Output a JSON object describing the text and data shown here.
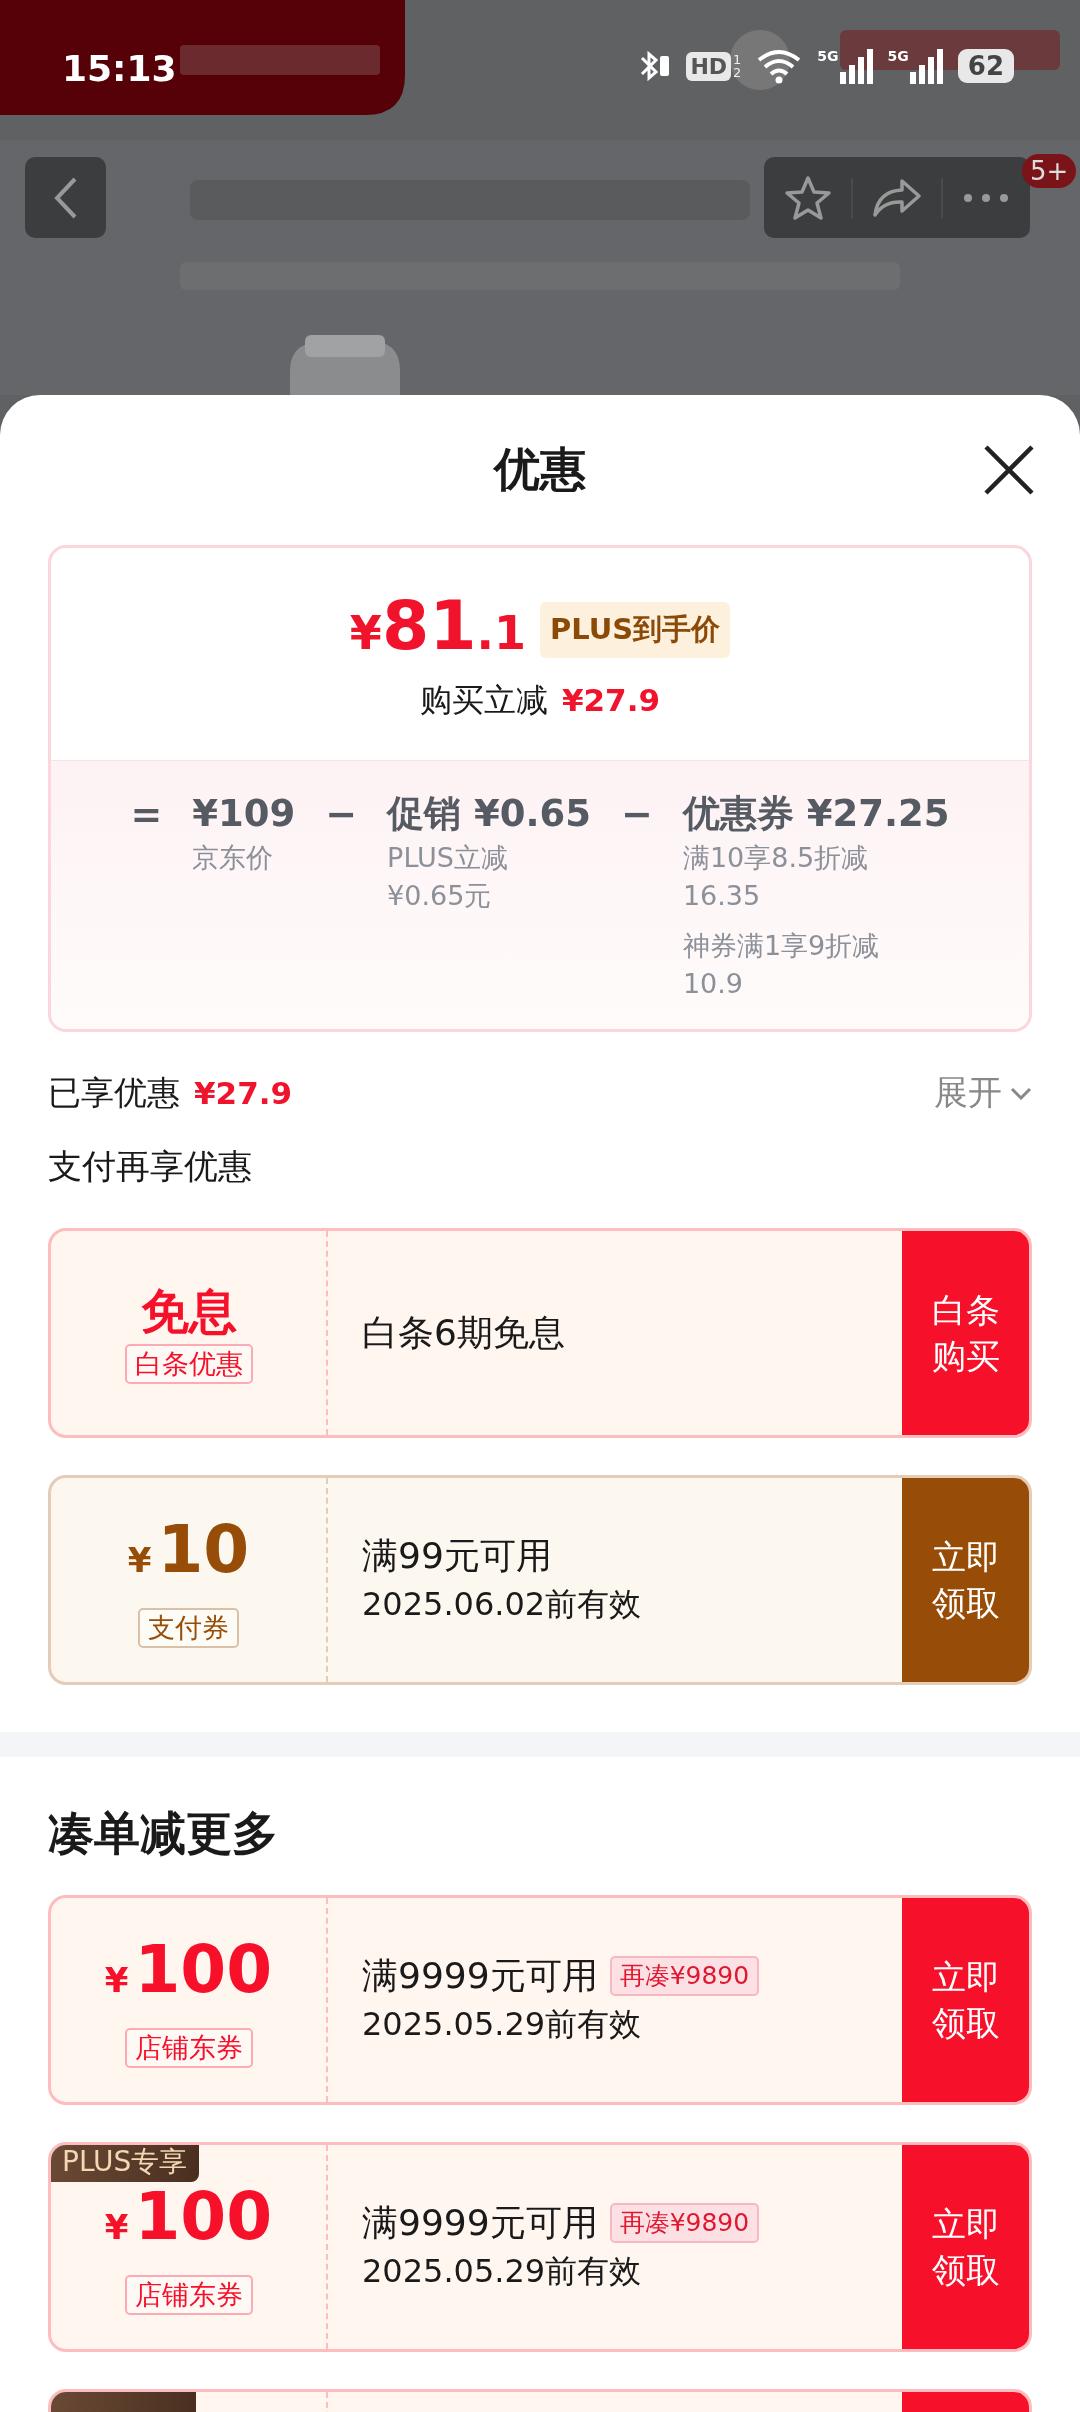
{
  "status_bar": {
    "time": "15:13",
    "hd": "HD",
    "sim_slots": [
      "1",
      "2"
    ],
    "networks": [
      "5G",
      "5G"
    ],
    "battery": "62"
  },
  "product_header": {
    "notification_count": "5+"
  },
  "sheet": {
    "title": "优惠"
  },
  "price_card": {
    "currency": "¥",
    "price_integer": "81",
    "price_decimal": ".1",
    "price_tag": "PLUS到手价",
    "saving_label": "购买立减",
    "saving_amount": "¥27.9",
    "breakdown": [
      {
        "operator": "=",
        "amount": "¥109",
        "notes": [
          {
            "lines": [
              "京东价"
            ]
          }
        ]
      },
      {
        "operator": "−",
        "label": "促销",
        "amount": "¥0.65",
        "notes": [
          {
            "lines": [
              "PLUS立减",
              "¥0.65元"
            ]
          }
        ]
      },
      {
        "operator": "−",
        "label": "优惠券",
        "amount": "¥27.25",
        "notes": [
          {
            "lines": [
              "满10享8.5折减",
              "16.35"
            ]
          },
          {
            "lines": [
              "神券满1享9折减",
              "10.9"
            ]
          }
        ]
      }
    ]
  },
  "savings_row": {
    "label": "已享优惠",
    "amount": "¥27.9",
    "expand": "展开",
    "expanded": false
  },
  "pay_section": {
    "title": "支付再享优惠",
    "coupons": [
      {
        "kind": "free",
        "color": "#f7102a",
        "headline": "免息",
        "tag": "白条优惠",
        "condition": "白条6期免息",
        "action": "白条购买"
      },
      {
        "kind": "amount",
        "color": "#974c07",
        "currency": "¥",
        "amount": "10",
        "tag": "支付券",
        "condition": "满99元可用",
        "validity": "2025.06.02前有效",
        "action": "立即领取"
      }
    ]
  },
  "bundle_section": {
    "title": "凑单减更多",
    "coupons": [
      {
        "kind": "amount",
        "color": "#f7102a",
        "currency": "¥",
        "amount": "100",
        "tag": "店铺东券",
        "condition": "满9999元可用",
        "extra_tag": "再凑¥9890",
        "validity": "2025.05.29前有效",
        "action": "立即领取"
      },
      {
        "kind": "amount",
        "color": "#f7102a",
        "plus_badge": "PLUS专享",
        "currency": "¥",
        "amount": "100",
        "tag": "店铺东券",
        "condition": "满9999元可用",
        "extra_tag": "再凑¥9890",
        "validity": "2025.05.29前有效",
        "action": "立即领取"
      },
      {
        "kind": "amount",
        "color": "#f7102a",
        "plus_badge_cut_off": true
      }
    ]
  }
}
